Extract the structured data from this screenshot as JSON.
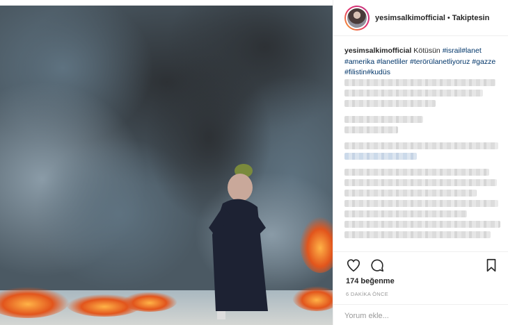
{
  "post": {
    "username": "yesimsalkimofficial",
    "separator": "•",
    "follow_status": "Takiptesin",
    "caption": {
      "username": "yesimsalkimofficial",
      "text": "Kötüsün",
      "hashtags": [
        "#israil",
        "#lanet",
        "#amerika",
        "#lanetliler",
        "#terörülanetliyoruz",
        "#gazze",
        "#filistin",
        "#kudüs"
      ]
    },
    "likes": "174 beğenme",
    "timestamp": "6 DAKİKA ÖNCE",
    "comment_placeholder": "Yorum ekle..."
  },
  "icons": {
    "like": "heart-icon",
    "comment": "speech-bubble-icon",
    "save": "bookmark-icon"
  },
  "colors": {
    "hashtag": "#003569",
    "text": "#262626",
    "muted": "#999999",
    "border": "#efefef"
  }
}
